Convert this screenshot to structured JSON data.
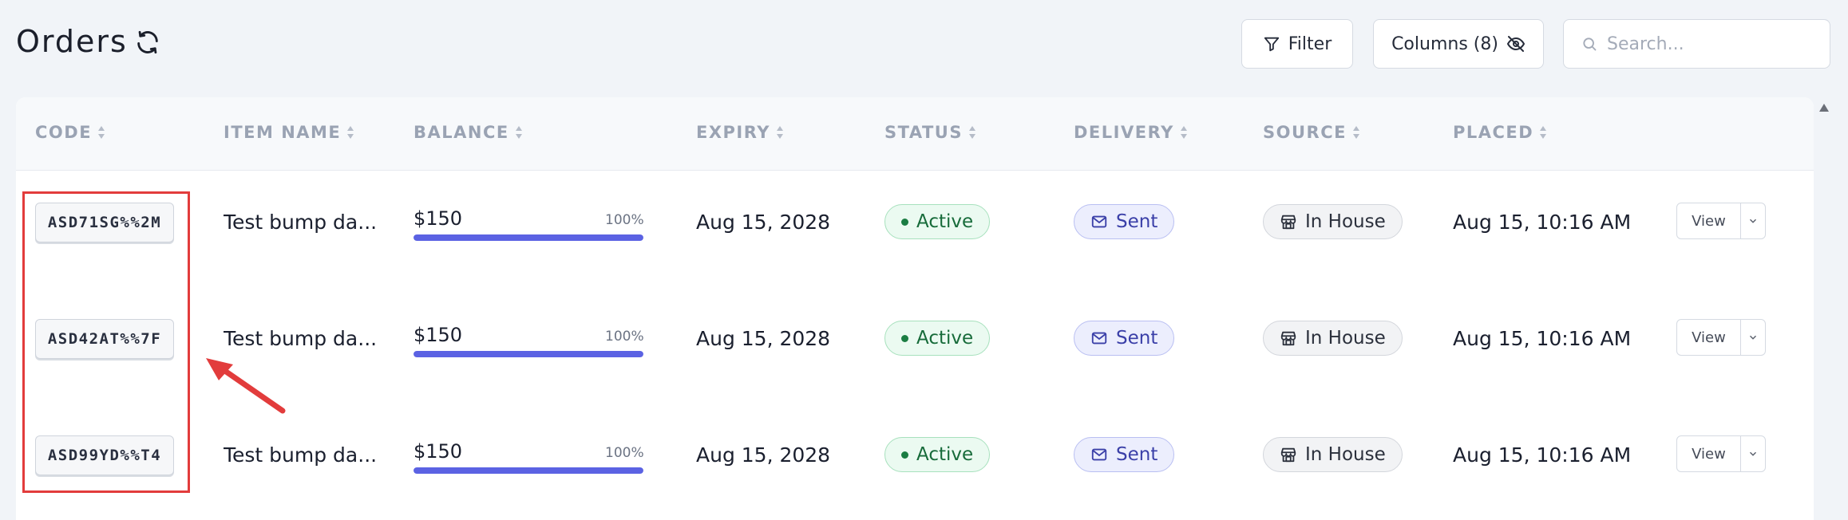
{
  "page": {
    "title": "Orders"
  },
  "toolbar": {
    "filter_label": "Filter",
    "columns_label": "Columns (8)",
    "search_placeholder": "Search..."
  },
  "columns": [
    "CODE",
    "ITEM NAME",
    "BALANCE",
    "EXPIRY",
    "STATUS",
    "DELIVERY",
    "SOURCE",
    "PLACED"
  ],
  "rows": [
    {
      "code": "ASD71SG%%2M",
      "item_name": "Test bump da...",
      "balance": "$150",
      "balance_pct": "100%",
      "balance_fraction": 1.0,
      "expiry": "Aug 15, 2028",
      "status": "Active",
      "delivery": "Sent",
      "source": "In House",
      "placed": "Aug 15, 10:16 AM",
      "action": "View"
    },
    {
      "code": "ASD42AT%%7F",
      "item_name": "Test bump da...",
      "balance": "$150",
      "balance_pct": "100%",
      "balance_fraction": 1.0,
      "expiry": "Aug 15, 2028",
      "status": "Active",
      "delivery": "Sent",
      "source": "In House",
      "placed": "Aug 15, 10:16 AM",
      "action": "View"
    },
    {
      "code": "ASD99YD%%T4",
      "item_name": "Test bump da...",
      "balance": "$150",
      "balance_pct": "100%",
      "balance_fraction": 1.0,
      "expiry": "Aug 15, 2028",
      "status": "Active",
      "delivery": "Sent",
      "source": "In House",
      "placed": "Aug 15, 10:16 AM",
      "action": "View"
    }
  ],
  "icons": {
    "refresh": "refresh-icon",
    "filter": "filter-icon",
    "columns": "eye-off-icon",
    "search": "search-icon",
    "sort": "sort-icon",
    "delivery": "mail-icon",
    "source": "store-icon",
    "dropdown": "chevron-down-icon"
  },
  "colors": {
    "annotation": "#e23c3c",
    "progress": "#5b62e3",
    "status_active": "#176b3a",
    "delivery_sent": "#3a3fa8"
  }
}
